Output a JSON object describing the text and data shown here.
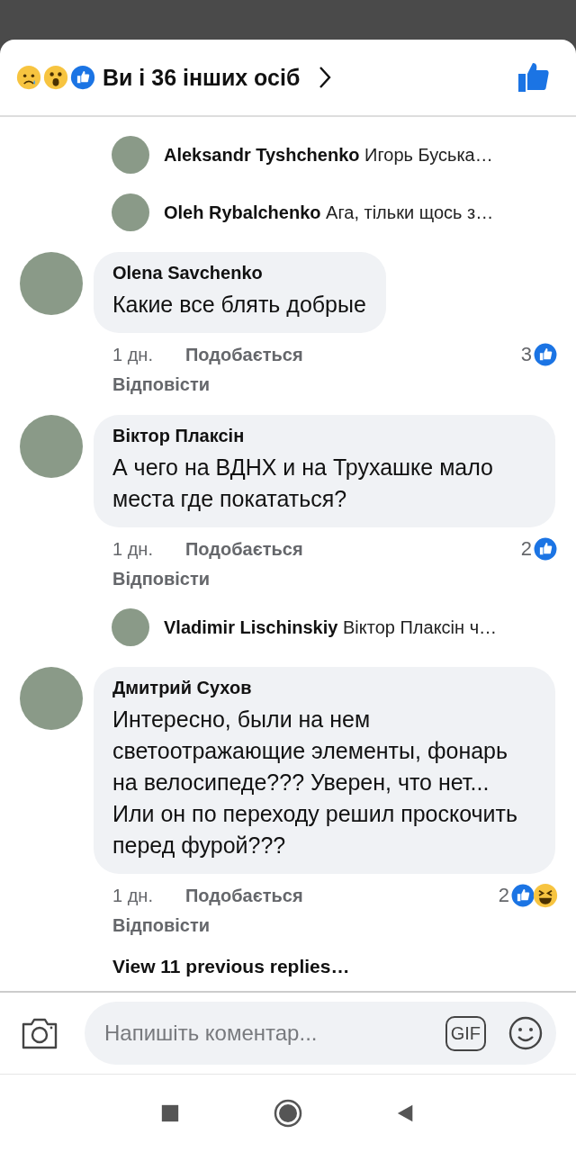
{
  "header": {
    "reactions": [
      {
        "kind": "sad"
      },
      {
        "kind": "wow"
      },
      {
        "kind": "like"
      }
    ],
    "summary": "Ви і 36 інших осіб",
    "like_selected": true
  },
  "comments": [
    {
      "kind": "reply-preview",
      "author": "Aleksandr Tyshchenko",
      "text": "Игорь Буська…"
    },
    {
      "kind": "reply-preview",
      "author": "Oleh Rybalchenko",
      "text": "Ага, тільки щось з…"
    },
    {
      "kind": "comment",
      "author": "Olena Savchenko",
      "text": "Какие все блять добрые",
      "time": "1 дн.",
      "like": "Подобається",
      "reply": "Відповісти",
      "count": "3",
      "reactions": [
        {
          "kind": "like"
        }
      ]
    },
    {
      "kind": "comment",
      "author": "Віктор Плаксін",
      "text": "А чего на ВДНХ и на Трухашке мало места где покататься?",
      "time": "1 дн.",
      "like": "Подобається",
      "reply": "Відповісти",
      "count": "2",
      "reactions": [
        {
          "kind": "like"
        }
      ]
    },
    {
      "kind": "reply-preview",
      "author": "Vladimir Lischinskiy",
      "text": "Віктор Плаксін ч…"
    },
    {
      "kind": "comment",
      "author": "Дмитрий Сухов",
      "text": "Интересно, были на нем светоотражающие элементы, фонарь на велосипеде??? Уверен, что нет... Или он по переходу решил проскочить перед фурой???",
      "time": "1 дн.",
      "like": "Подобається",
      "reply": "Відповісти",
      "count": "2",
      "reactions": [
        {
          "kind": "like"
        },
        {
          "kind": "haha"
        }
      ]
    }
  ],
  "more_replies": "View 11 previous replies…",
  "composer": {
    "placeholder": "Напишіть коментар...",
    "gif": "GIF"
  }
}
